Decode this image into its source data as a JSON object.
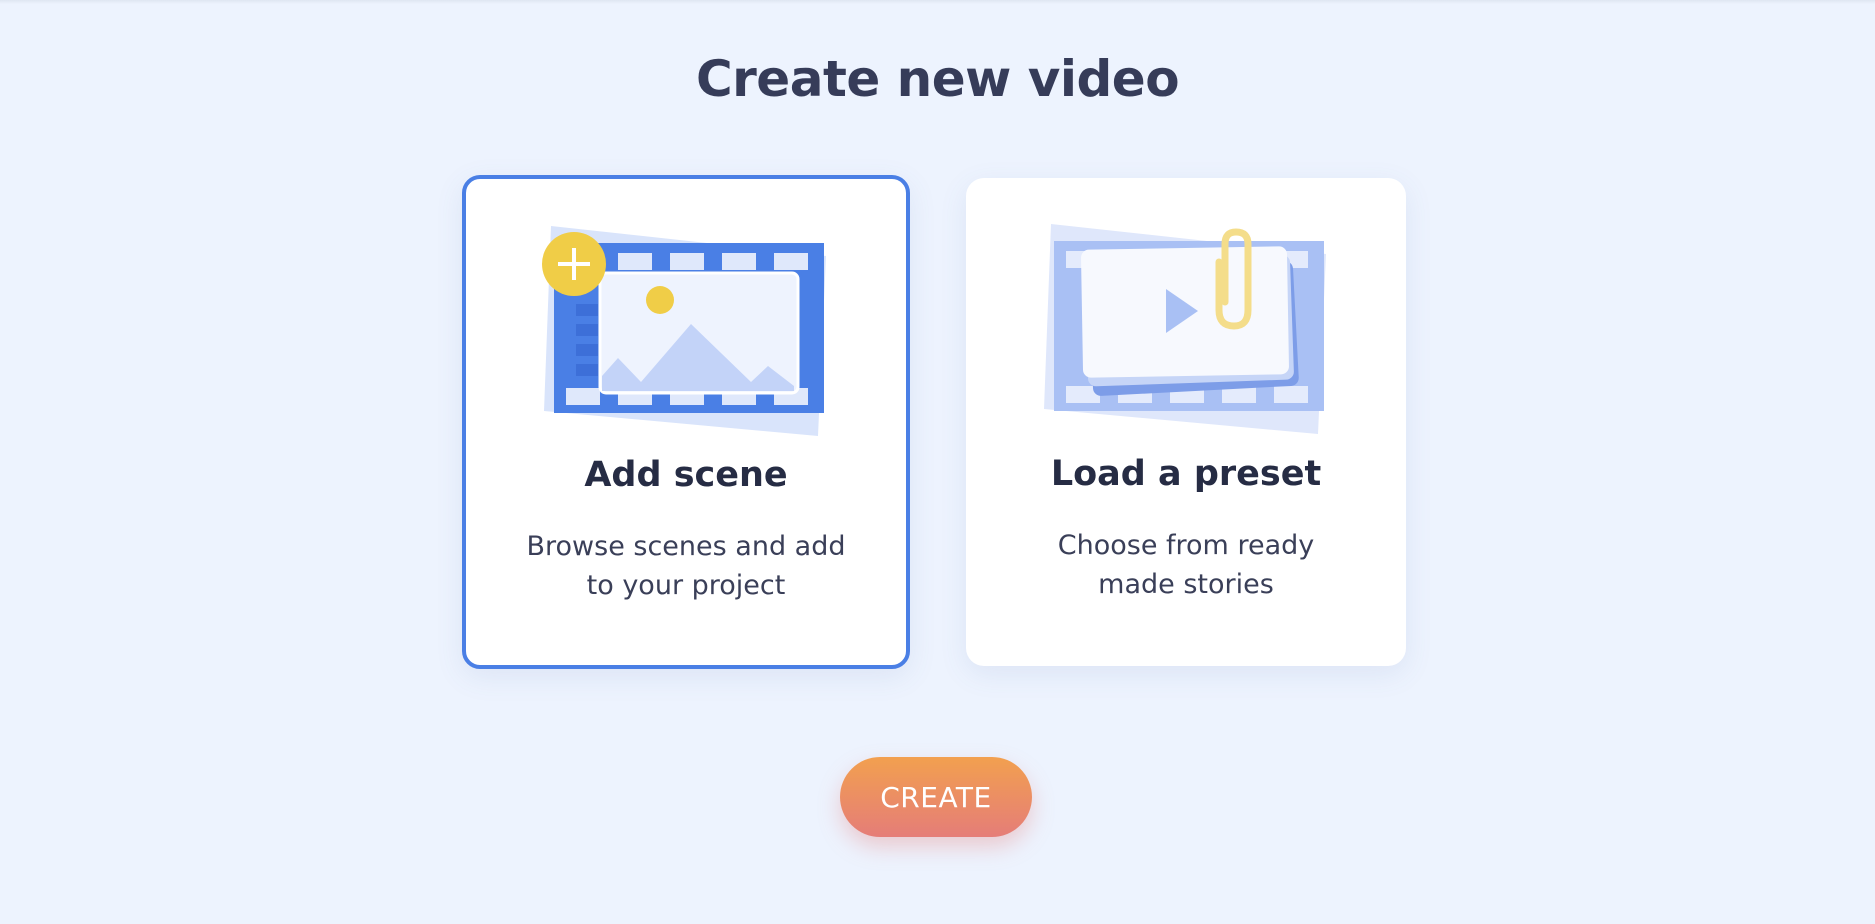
{
  "header": {
    "title": "Create new video"
  },
  "options": [
    {
      "id": "add-scene",
      "title": "Add scene",
      "description": "Browse scenes and add to your project",
      "selected": true,
      "icon": "film-image-plus-icon"
    },
    {
      "id": "load-preset",
      "title": "Load a preset",
      "description": "Choose from ready made stories",
      "selected": false,
      "icon": "film-stack-play-clip-icon"
    }
  ],
  "actions": {
    "create_label": "CREATE"
  },
  "colors": {
    "background": "#edf3fe",
    "accent": "#4a7fe5",
    "title_text": "#363c59",
    "button_gradient_top": "#f2a04f",
    "button_gradient_bottom": "#e57d78",
    "plus_badge": "#f0cd47"
  }
}
